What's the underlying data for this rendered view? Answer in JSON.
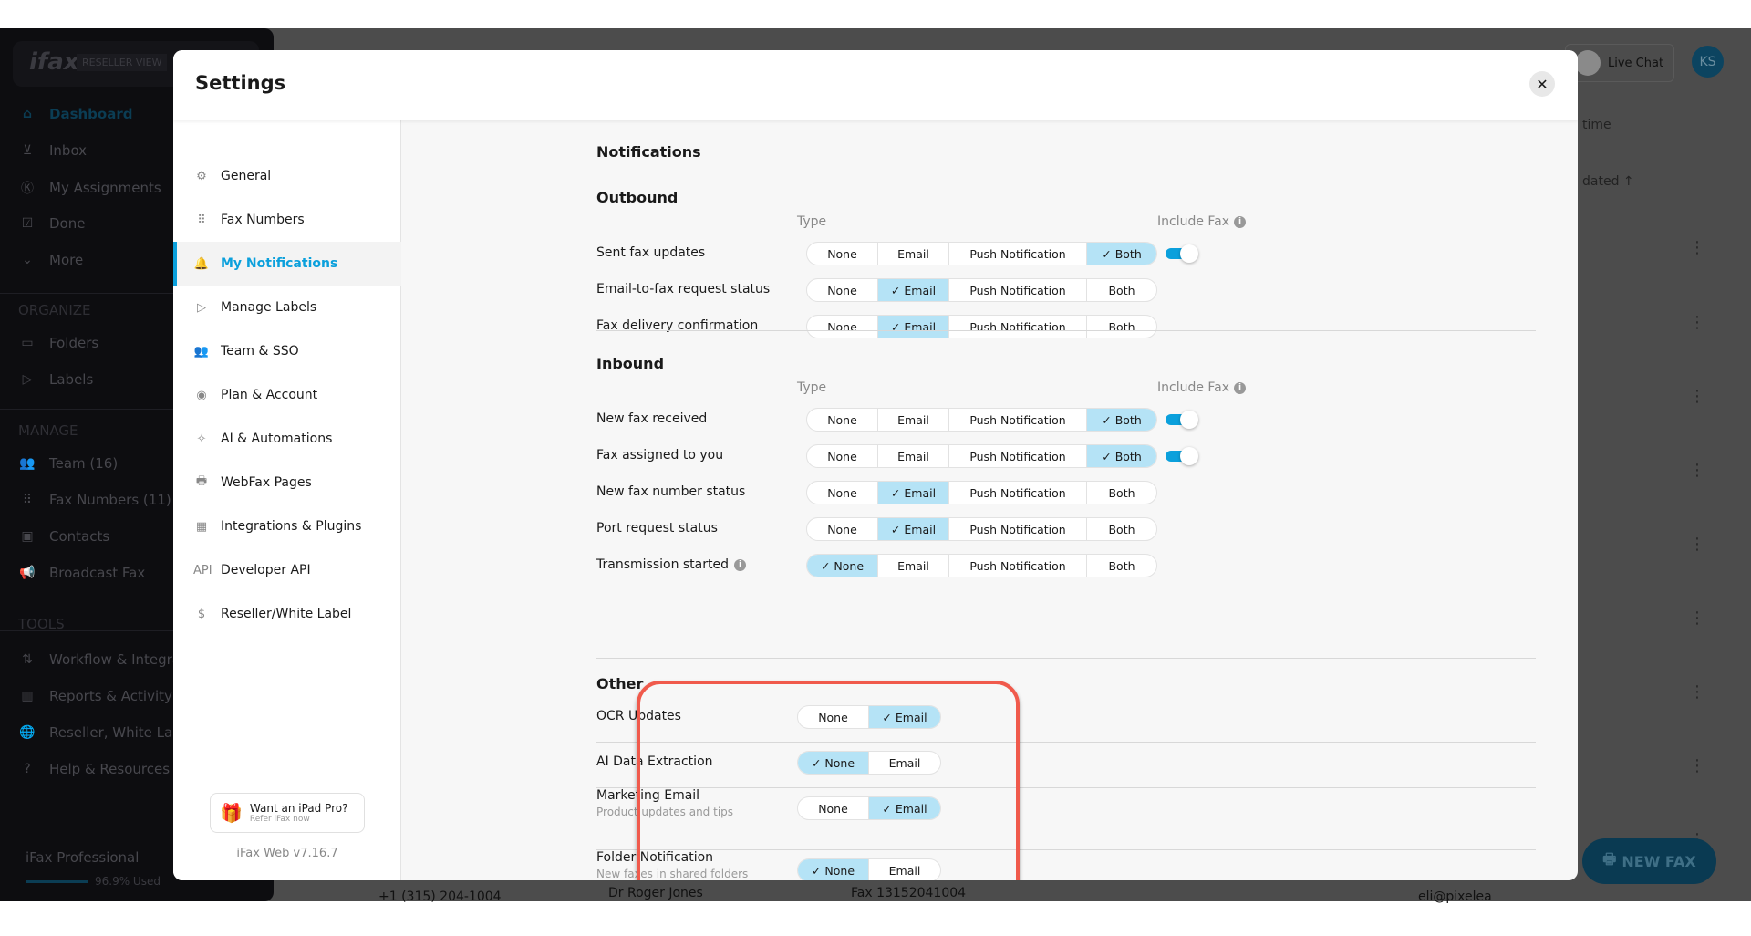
{
  "background": {
    "logo": "ifax",
    "reseller_view": "RESELLER VIEW",
    "sidebar": [
      {
        "label": "Dashboard",
        "icon": "home-icon"
      },
      {
        "label": "Inbox",
        "icon": "inbox-icon"
      },
      {
        "label": "My Assignments",
        "icon": "ks-avatar-icon"
      },
      {
        "label": "Done",
        "icon": "done-icon"
      },
      {
        "label": "More",
        "icon": "chevron-down-icon"
      }
    ],
    "organize_heading": "ORGANIZE",
    "organize": [
      {
        "label": "Folders",
        "icon": "folder-icon"
      },
      {
        "label": "Labels",
        "icon": "label-icon"
      }
    ],
    "manage_heading": "MANAGE",
    "manage": [
      {
        "label": "Team (16)",
        "icon": "team-icon"
      },
      {
        "label": "Fax Numbers (11)",
        "icon": "dialpad-icon"
      },
      {
        "label": "Contacts",
        "icon": "contacts-icon"
      },
      {
        "label": "Broadcast Fax",
        "icon": "megaphone-icon"
      }
    ],
    "tools_heading": "TOOLS",
    "tools": [
      {
        "label": "Workflow & Integrat",
        "icon": "workflow-icon"
      },
      {
        "label": "Reports & Activity",
        "icon": "reports-icon"
      },
      {
        "label": "Reseller, White Lab",
        "icon": "globe-icon"
      },
      {
        "label": "Help & Resources",
        "icon": "help-icon"
      }
    ],
    "plan": "iFax Professional",
    "usage": "96.9% Used",
    "usage_percent": 96.9,
    "live_chat": "Live Chat",
    "avatar": "KS",
    "sort_select": "time",
    "sort_column": "dated ↑",
    "row": {
      "phone": "+1 (315) 204-1004",
      "name": "Dr Roger Jones",
      "fax": "Fax 13152041004",
      "email": "eli@pixelea"
    },
    "new_fax": "NEW FAX"
  },
  "settings": {
    "title": "Settings",
    "nav": [
      {
        "label": "General",
        "icon": "gear-icon"
      },
      {
        "label": "Fax Numbers",
        "icon": "dialpad-hand-icon"
      },
      {
        "label": "My Notifications",
        "icon": "bell-icon",
        "active": true
      },
      {
        "label": "Manage Labels",
        "icon": "label-icon"
      },
      {
        "label": "Team & SSO",
        "icon": "team-icon"
      },
      {
        "label": "Plan & Account",
        "icon": "user-circle-icon"
      },
      {
        "label": "AI & Automations",
        "icon": "sparkle-icon"
      },
      {
        "label": "WebFax Pages",
        "icon": "printer-icon"
      },
      {
        "label": "Integrations & Plugins",
        "icon": "grid-icon"
      },
      {
        "label": "Developer API",
        "icon": "api-icon"
      },
      {
        "label": "Reseller/White Label",
        "icon": "dollar-circle-icon"
      }
    ],
    "promo": {
      "title": "Want an iPad Pro?",
      "subtitle": "Refer iFax now"
    },
    "version": "iFax Web v7.16.7",
    "heading": "Notifications",
    "type_label": "Type",
    "include_fax_label": "Include Fax",
    "options": [
      "None",
      "Email",
      "Push Notification",
      "Both"
    ],
    "outbound": {
      "heading": "Outbound",
      "rows": [
        {
          "label": "Sent fax updates",
          "selected": "Both",
          "include_fax": true
        },
        {
          "label": "Email-to-fax request status",
          "selected": "Email"
        },
        {
          "label": "Fax delivery confirmation",
          "selected": "Email"
        }
      ]
    },
    "inbound": {
      "heading": "Inbound",
      "rows": [
        {
          "label": "New fax received",
          "selected": "Both",
          "include_fax": true
        },
        {
          "label": "Fax assigned to you",
          "selected": "Both",
          "include_fax": true
        },
        {
          "label": "New fax number status",
          "selected": "Email"
        },
        {
          "label": "Port request status",
          "selected": "Email"
        },
        {
          "label": "Transmission started",
          "selected": "None",
          "info": true
        }
      ]
    },
    "other": {
      "heading": "Other",
      "options": [
        "None",
        "Email"
      ],
      "rows": [
        {
          "label": "OCR Updates",
          "selected": "Email"
        },
        {
          "label": "AI Data Extraction",
          "selected": "None"
        },
        {
          "label": "Marketing Email",
          "sub": "Product updates and tips",
          "selected": "Email"
        },
        {
          "label": "Folder Notification",
          "sub": "New faxes in shared folders",
          "selected": "None"
        }
      ]
    },
    "accent": "#0ba0dc",
    "selected_bg": "#b5e3f6",
    "highlight": "#f05a4c"
  }
}
